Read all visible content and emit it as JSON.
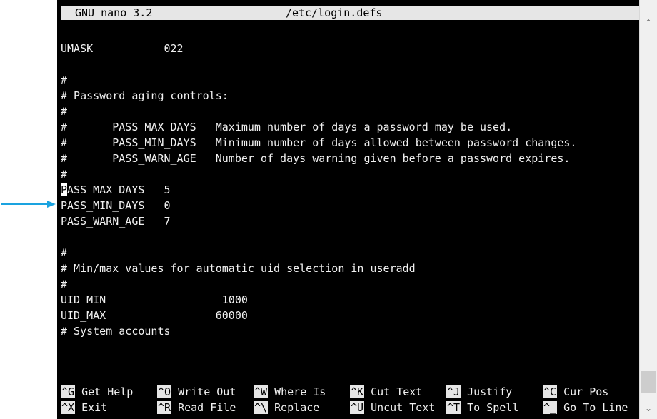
{
  "titlebar": {
    "app": "GNU nano 3.2",
    "file": "/etc/login.defs"
  },
  "lines": [
    "UMASK           022",
    "",
    "#",
    "# Password aging controls:",
    "#",
    "#       PASS_MAX_DAYS   Maximum number of days a password may be used.",
    "#       PASS_MIN_DAYS   Minimum number of days allowed between password changes.",
    "#       PASS_WARN_AGE   Number of days warning given before a password expires.",
    "#",
    "PASS_MAX_DAYS   5",
    "PASS_MIN_DAYS   0",
    "PASS_WARN_AGE   7",
    "",
    "#",
    "# Min/max values for automatic uid selection in useradd",
    "#",
    "UID_MIN                  1000",
    "UID_MAX                 60000",
    "# System accounts"
  ],
  "cursor_line": {
    "first_char": "P",
    "rest": "ASS_MAX_DAYS   5"
  },
  "shortcuts": {
    "row1": [
      {
        "key": "^G",
        "label": "Get Help"
      },
      {
        "key": "^O",
        "label": "Write Out"
      },
      {
        "key": "^W",
        "label": "Where Is"
      },
      {
        "key": "^K",
        "label": "Cut Text"
      },
      {
        "key": "^J",
        "label": "Justify"
      },
      {
        "key": "^C",
        "label": "Cur Pos"
      }
    ],
    "row2": [
      {
        "key": "^X",
        "label": "Exit"
      },
      {
        "key": "^R",
        "label": "Read File"
      },
      {
        "key": "^\\",
        "label": "Replace"
      },
      {
        "key": "^U",
        "label": "Uncut Text"
      },
      {
        "key": "^T",
        "label": "To Spell"
      },
      {
        "key": "^_",
        "label": "Go To Line"
      }
    ]
  },
  "colors": {
    "terminal_bg": "#000000",
    "text": "#f0f0f0",
    "bar": "#e6e6e6",
    "annotation_arrow": "#1aa3e0"
  },
  "icons": {
    "annotation": "right-arrow-icon",
    "scroll_up": "chevron-up-icon",
    "scroll_down": "chevron-down-icon"
  }
}
